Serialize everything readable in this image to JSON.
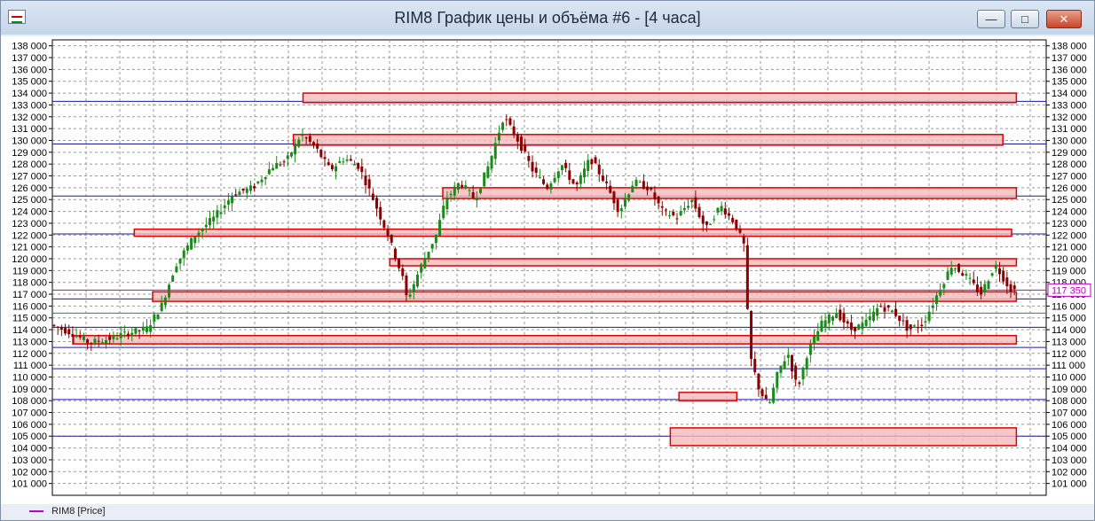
{
  "window": {
    "title": "RIM8 График цены и объёма #6 - [4 часа]",
    "minimize_icon": "minimize-icon",
    "restore_icon": "restore-icon",
    "close_icon": "close-icon"
  },
  "legend": {
    "label": "RIM8 [Price]",
    "color": "#c000c0"
  },
  "colors": {
    "bull": "#1a8a1a",
    "bear": "#8b0000",
    "zone_fill": "#f6b9b9",
    "zone_stroke": "#e00000",
    "level_line": "#1a1aa0",
    "green_line": "#1a9a1a"
  },
  "chart_data": {
    "type": "candlestick",
    "y_range": [
      100000,
      138500
    ],
    "y_ticks": [
      101000,
      102000,
      103000,
      104000,
      105000,
      106000,
      107000,
      108000,
      109000,
      110000,
      111000,
      112000,
      113000,
      114000,
      115000,
      116000,
      117000,
      118000,
      119000,
      120000,
      121000,
      122000,
      123000,
      124000,
      125000,
      126000,
      127000,
      128000,
      129000,
      130000,
      131000,
      132000,
      133000,
      134000,
      135000,
      136000,
      137000,
      138000
    ],
    "tick_labels": [
      "101 000",
      "102 000",
      "103 000",
      "104 000",
      "105 000",
      "106 000",
      "107 000",
      "108 000",
      "109 000",
      "110 000",
      "111 000",
      "112 000",
      "113 000",
      "114 000",
      "115 000",
      "116 000",
      "117 000",
      "118 000",
      "119 000",
      "120 000",
      "121 000",
      "122 000",
      "123 000",
      "124 000",
      "125 000",
      "126 000",
      "127 000",
      "128 000",
      "129 000",
      "130 000",
      "131 000",
      "132 000",
      "133 000",
      "134 000",
      "135 000",
      "136 000",
      "137 000",
      "138 000"
    ],
    "current_price": 117350,
    "current_price_label": "117 350",
    "horizontal_levels": [
      133300,
      129700,
      125300,
      122100,
      117350,
      116600,
      115400,
      114200,
      112500,
      110700,
      108100,
      105000
    ],
    "zones": [
      {
        "x1": 0.26,
        "x2": 1.0,
        "low": 133200,
        "high": 134000
      },
      {
        "x1": 0.25,
        "x2": 0.986,
        "low": 129600,
        "high": 130500
      },
      {
        "x1": 0.405,
        "x2": 1.0,
        "low": 125100,
        "high": 126000
      },
      {
        "x1": 0.085,
        "x2": 0.995,
        "low": 121900,
        "high": 122500
      },
      {
        "x1": 0.35,
        "x2": 1.0,
        "low": 119400,
        "high": 120000
      },
      {
        "x1": 0.104,
        "x2": 1.0,
        "low": 116400,
        "high": 117200
      },
      {
        "x1": 0.022,
        "x2": 1.0,
        "low": 112800,
        "high": 113500
      },
      {
        "x1": 0.65,
        "x2": 0.71,
        "low": 108000,
        "high": 108700
      },
      {
        "x1": 0.641,
        "x2": 1.0,
        "low": 104200,
        "high": 105700
      }
    ],
    "path": [
      [
        0.0,
        114400
      ],
      [
        0.02,
        113800
      ],
      [
        0.04,
        112900
      ],
      [
        0.06,
        113200
      ],
      [
        0.08,
        113700
      ],
      [
        0.1,
        114100
      ],
      [
        0.115,
        116000
      ],
      [
        0.13,
        119500
      ],
      [
        0.15,
        122000
      ],
      [
        0.17,
        123500
      ],
      [
        0.19,
        125500
      ],
      [
        0.21,
        126000
      ],
      [
        0.23,
        127800
      ],
      [
        0.245,
        128300
      ],
      [
        0.26,
        130500
      ],
      [
        0.275,
        129400
      ],
      [
        0.29,
        127500
      ],
      [
        0.305,
        128500
      ],
      [
        0.32,
        127800
      ],
      [
        0.335,
        125000
      ],
      [
        0.35,
        122000
      ],
      [
        0.365,
        118500
      ],
      [
        0.37,
        116500
      ],
      [
        0.385,
        119500
      ],
      [
        0.4,
        122000
      ],
      [
        0.41,
        125000
      ],
      [
        0.425,
        126500
      ],
      [
        0.44,
        125000
      ],
      [
        0.455,
        128000
      ],
      [
        0.47,
        132000
      ],
      [
        0.485,
        130000
      ],
      [
        0.5,
        127500
      ],
      [
        0.515,
        126000
      ],
      [
        0.53,
        128000
      ],
      [
        0.545,
        126000
      ],
      [
        0.56,
        128500
      ],
      [
        0.575,
        126500
      ],
      [
        0.59,
        124000
      ],
      [
        0.605,
        126500
      ],
      [
        0.62,
        126000
      ],
      [
        0.635,
        124000
      ],
      [
        0.65,
        123500
      ],
      [
        0.665,
        125000
      ],
      [
        0.68,
        122500
      ],
      [
        0.695,
        124500
      ],
      [
        0.71,
        123000
      ],
      [
        0.72,
        121000
      ],
      [
        0.725,
        112000
      ],
      [
        0.735,
        109000
      ],
      [
        0.745,
        107500
      ],
      [
        0.755,
        110500
      ],
      [
        0.765,
        112000
      ],
      [
        0.775,
        109000
      ],
      [
        0.785,
        112000
      ],
      [
        0.8,
        114500
      ],
      [
        0.815,
        115500
      ],
      [
        0.83,
        114000
      ],
      [
        0.845,
        114500
      ],
      [
        0.86,
        116000
      ],
      [
        0.875,
        115500
      ],
      [
        0.89,
        114000
      ],
      [
        0.905,
        114500
      ],
      [
        0.92,
        117000
      ],
      [
        0.935,
        119500
      ],
      [
        0.95,
        118500
      ],
      [
        0.965,
        117000
      ],
      [
        0.98,
        119500
      ],
      [
        0.995,
        117500
      ],
      [
        1.0,
        117350
      ]
    ]
  }
}
